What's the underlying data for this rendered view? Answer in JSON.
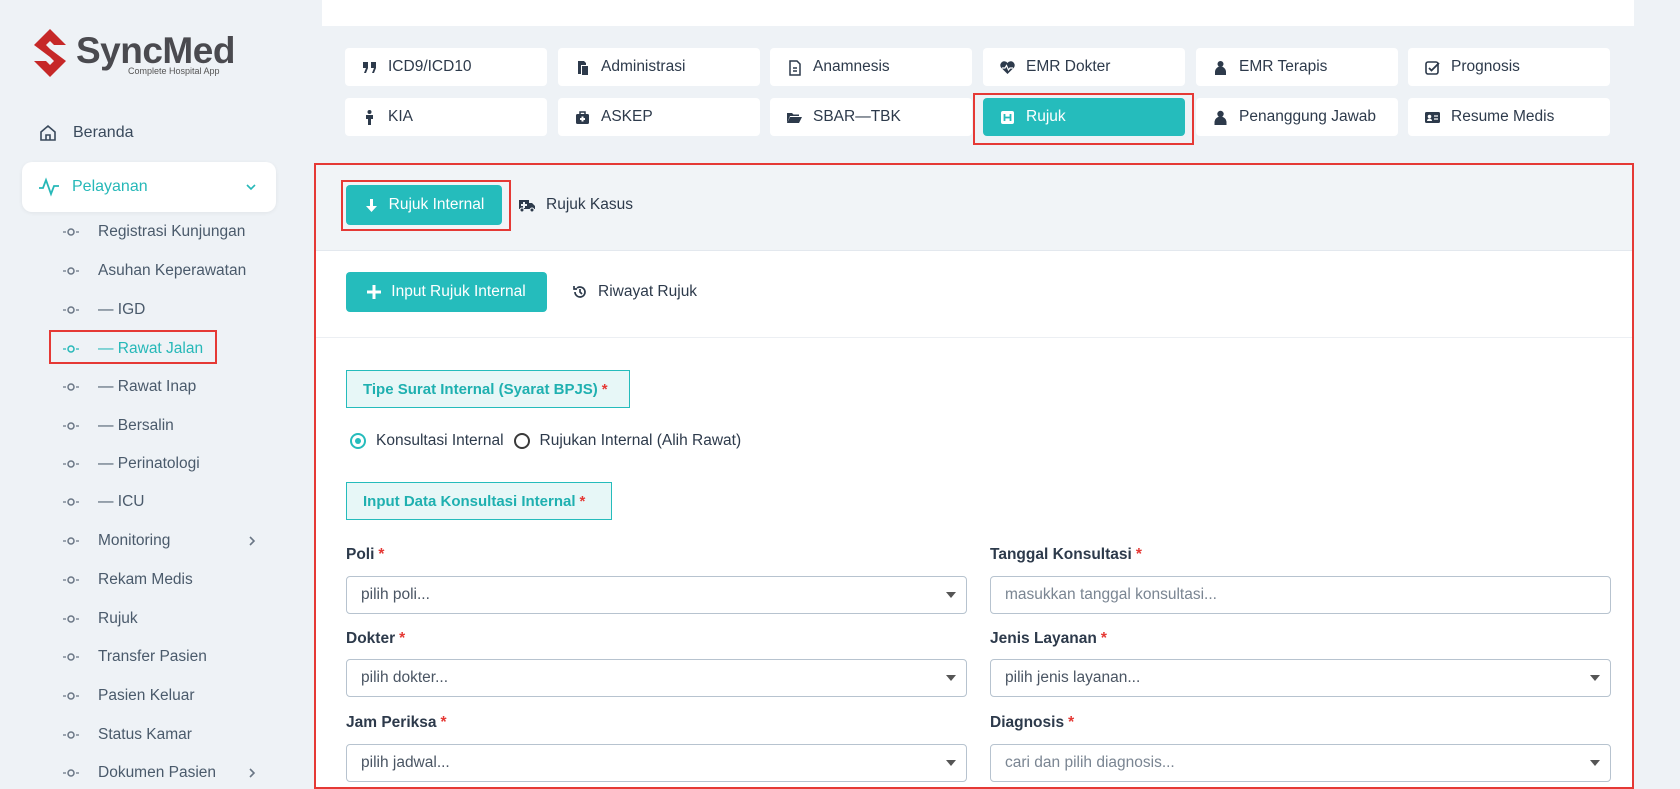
{
  "brand": {
    "name": "SyncMed",
    "tagline": "Complete Hospital App",
    "color": "#c62828"
  },
  "sidebar": {
    "beranda": "Beranda",
    "pelayanan": "Pelayanan",
    "items": [
      "Registrasi Kunjungan",
      "Asuhan Keperawatan",
      "— IGD",
      "— Rawat Jalan",
      "— Rawat Inap",
      "— Bersalin",
      "— Perinatologi",
      "— ICU",
      "Monitoring",
      "Rekam Medis",
      "Rujuk",
      "Transfer Pasien",
      "Pasien Keluar",
      "Status Kamar",
      "Dokumen Pasien"
    ],
    "active_item": "— Rawat Jalan"
  },
  "tabs": {
    "row1": [
      "ICD9/ICD10",
      "Administrasi",
      "Anamnesis",
      "EMR Dokter",
      "EMR Terapis",
      "Prognosis"
    ],
    "row2": [
      "KIA",
      "ASKEP",
      "SBAR—TBK",
      "Rujuk",
      "Penanggung Jawab",
      "Resume Medis"
    ],
    "active": "Rujuk"
  },
  "subtabs": {
    "rujuk_internal": "Rujuk Internal",
    "rujuk_kasus": "Rujuk Kasus"
  },
  "actions": {
    "input_rujuk_internal": "Input Rujuk Internal",
    "riwayat_rujuk": "Riwayat Rujuk"
  },
  "form": {
    "tipe_surat_label": "Tipe Surat Internal (Syarat BPJS)",
    "radio_options": [
      "Konsultasi Internal",
      "Rujukan Internal (Alih Rawat)"
    ],
    "radio_selected": "Konsultasi Internal",
    "input_data_label": "Input Data Konsultasi Internal",
    "required_mark": "*",
    "fields": {
      "poli": {
        "label": "Poli",
        "placeholder": "pilih poli..."
      },
      "tanggal": {
        "label": "Tanggal Konsultasi",
        "placeholder": "masukkan tanggal konsultasi..."
      },
      "dokter": {
        "label": "Dokter",
        "placeholder": "pilih dokter..."
      },
      "jenis_layanan": {
        "label": "Jenis Layanan",
        "placeholder": "pilih jenis layanan..."
      },
      "jam_periksa": {
        "label": "Jam Periksa",
        "placeholder": "pilih jadwal..."
      },
      "diagnosis": {
        "label": "Diagnosis",
        "placeholder": "cari dan pilih diagnosis..."
      }
    }
  },
  "colors": {
    "accent": "#25bcbc",
    "highlight": "#e53935",
    "background": "#eef2f6"
  }
}
